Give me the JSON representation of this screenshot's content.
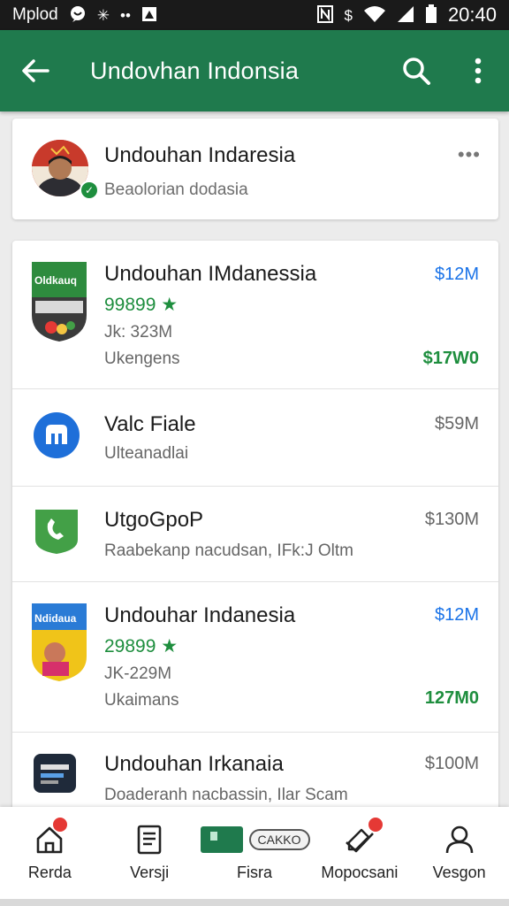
{
  "status_bar": {
    "carrier": "Mplod",
    "time": "20:40",
    "icons_left": [
      "chat-bubble-icon",
      "settings-burst-icon",
      "dots-icon",
      "image-icon"
    ],
    "icons_right": [
      "nfc-icon",
      "dollar-icon",
      "wifi-icon",
      "signal-icon",
      "battery-icon"
    ]
  },
  "app_bar": {
    "title": "Undovhan Indonsia",
    "back_icon": "arrow-left-icon",
    "search_icon": "search-icon",
    "menu_icon": "more-vert-icon",
    "background": "#1f7a4d"
  },
  "profile": {
    "name": "Undouhan Indaresia",
    "subtitle": "Beaolorian dodasia",
    "more": "•••"
  },
  "rows": [
    {
      "name": "Undouhan IMdanessia",
      "rating": "99899 ★",
      "line1": "Jk: 323M",
      "line2": "Ukengens",
      "price": "$12M",
      "price2": "$17W0"
    },
    {
      "name": "Valc Fiale",
      "line1": "Ulteanadlai",
      "price": "$59M"
    },
    {
      "name": "UtgoGpoP",
      "line1": "Raabekanp nacudsan, IFk:J Oltm",
      "price": "$130M"
    },
    {
      "name": "Undouhar Indanesia",
      "rating": "29899 ★",
      "line1": "JK-229M",
      "line2": "Ukaimans",
      "price": "$12M",
      "price2": "127M0"
    },
    {
      "name": "Undouhan Irkanaia",
      "line1": "Doaderanh nacbassin, Ilar Scam",
      "price": "$100M"
    }
  ],
  "row_icon_text": {
    "r1": "Oldkauq",
    "r4": "Ndidaua"
  },
  "bottom_nav": [
    {
      "label": "Rerda",
      "icon": "home-icon",
      "badge": true
    },
    {
      "label": "Versji",
      "icon": "document-icon",
      "badge": false
    },
    {
      "label": "Fisra",
      "icon": "ticket-icon",
      "badge": false,
      "pill_text": "CAKKO"
    },
    {
      "label": "Mopocsani",
      "icon": "edit-icon",
      "badge": true
    },
    {
      "label": "Vesgon",
      "icon": "person-icon",
      "badge": false
    }
  ],
  "colors": {
    "accent_green": "#1f7a4d",
    "price_blue": "#1a73e8",
    "rating_green": "#1e8e3e",
    "badge_red": "#e53935"
  }
}
